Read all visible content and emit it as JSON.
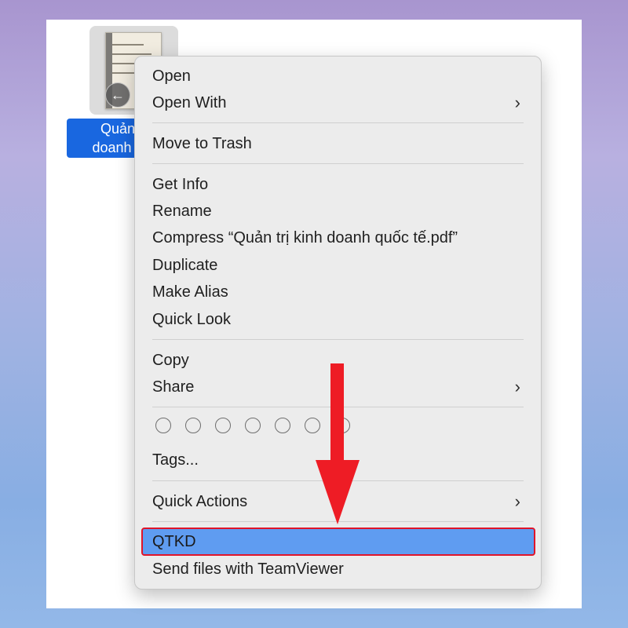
{
  "file": {
    "label_line1": "Quản t",
    "label_line2": "doanh qu",
    "badge_icon": "back-arrow-icon"
  },
  "menu": {
    "open": "Open",
    "open_with": "Open With",
    "move_to_trash": "Move to Trash",
    "get_info": "Get Info",
    "rename": "Rename",
    "compress": "Compress “Quản trị kinh doanh quốc tế.pdf”",
    "duplicate": "Duplicate",
    "make_alias": "Make Alias",
    "quick_look": "Quick Look",
    "copy": "Copy",
    "share": "Share",
    "tags": "Tags...",
    "quick_actions": "Quick Actions",
    "qtkd": "QTKD",
    "send_teamviewer": "Send files with TeamViewer",
    "chevron": "›"
  },
  "colors": {
    "highlight": "#5f9cf1",
    "highlight_border": "#e0152a",
    "arrow": "#ee1c25",
    "selection": "#1967e0"
  }
}
